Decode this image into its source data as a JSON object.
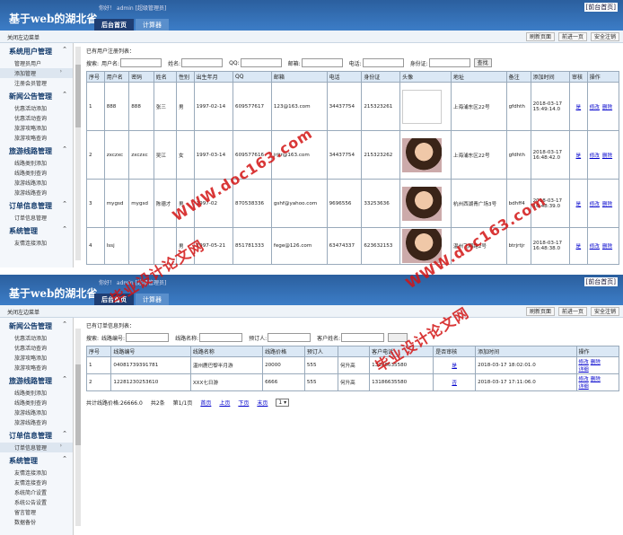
{
  "header": {
    "title": "基于web的湖北省",
    "hello": "你好！ admin [超级管理员]",
    "front": "[前台首页]",
    "tabs": [
      "后台首页",
      "计算器"
    ]
  },
  "toolbar": {
    "close": "关闭左边菜单",
    "buttons": [
      "刷新页面",
      "前进一页",
      "安全注销"
    ]
  },
  "watermark": {
    "text1": "毕业设计论文网",
    "text2": "WWW.doc163.com"
  },
  "users": {
    "sidebar": [
      {
        "title": "系统用户管理",
        "items": [
          "管理员用户",
          "添加管理",
          "注册会员管理"
        ],
        "selected": 1
      },
      {
        "title": "新闻公告管理",
        "items": [
          "优惠活动添加",
          "优惠活动查询",
          "旅游攻略添加",
          "旅游攻略查询"
        ]
      },
      {
        "title": "旅游线路管理",
        "items": [
          "线路类别添加",
          "线路类别查询",
          "旅游线路添加",
          "旅游线路查询"
        ]
      },
      {
        "title": "订单信息管理",
        "items": [
          "订单信息管理"
        ]
      },
      {
        "title": "系统管理",
        "items": [
          "友情连接添加"
        ]
      }
    ],
    "caption": "已有用户注册列表：",
    "search": {
      "label": "搜索:",
      "fields": [
        "用户名:",
        "姓名:",
        "QQ:",
        "邮箱:",
        "电话:",
        "身份证:"
      ],
      "button": "查找"
    },
    "columns": [
      "序号",
      "用户名",
      "密码",
      "姓名",
      "性别",
      "出生年月",
      "QQ",
      "邮箱",
      "电话",
      "身份证",
      "头像",
      "地址",
      "备注",
      "添加时间",
      "审核",
      "操作"
    ],
    "rows": [
      {
        "no": "1",
        "user": "888",
        "pwd": "888",
        "name": "张三",
        "sex": "男",
        "birth": "1997-02-14",
        "qq": "609577617",
        "email": "123@163.com",
        "tel": "34437754",
        "id": "215323261",
        "addr": "上海浦东区22号",
        "note": "gfdhth",
        "time1": "2018-03-17",
        "time2": "15:49:14.0",
        "audit": "是",
        "edit": "修改",
        "del": "删除"
      },
      {
        "no": "2",
        "user": "zxczxc",
        "pwd": "zxczxc",
        "name": "吴江",
        "sex": "女",
        "birth": "1997-03-14",
        "qq": "609577616",
        "email": "jrjtr@163.com",
        "tel": "34437754",
        "id": "215323262",
        "addr": "上海浦东区22号",
        "note": "gfdhth",
        "time1": "2018-03-17",
        "time2": "16:48:42.0",
        "audit": "是",
        "edit": "修改",
        "del": "删除"
      },
      {
        "no": "3",
        "user": "mygsd",
        "pwd": "mygsd",
        "name": "陈德才",
        "sex": "男",
        "birth": "1997-02",
        "qq": "870538336",
        "email": "gshf@yahoo.com",
        "tel": "9696556",
        "id": "33253636",
        "addr": "杭州西湖青广场3号",
        "note": "bdhff4",
        "time1": "2018-03-17",
        "time2": "16:48:39.0",
        "audit": "是",
        "edit": "修改",
        "del": "删除"
      },
      {
        "no": "4",
        "user": "lssj",
        "pwd": "",
        "name": "",
        "sex": "男",
        "birth": "1997-05-21",
        "qq": "851781333",
        "email": "fege@126.com",
        "tel": "63474337",
        "id": "623632153",
        "addr": "温州飞翔路2号",
        "note": "btrjrtjr",
        "time1": "2018-03-17",
        "time2": "16:48:38.0",
        "audit": "是",
        "edit": "修改",
        "del": "删除"
      }
    ]
  },
  "orders": {
    "sidebar": [
      {
        "title": "新闻公告管理",
        "items": [
          "优惠活动添加",
          "优惠活动查询",
          "旅游攻略添加",
          "旅游攻略查询"
        ]
      },
      {
        "title": "旅游线路管理",
        "items": [
          "线路类别添加",
          "线路类别查询",
          "旅游线路添加",
          "旅游线路查询"
        ]
      },
      {
        "title": "订单信息管理",
        "items": [
          "订单信息管理"
        ],
        "selected": 0
      },
      {
        "title": "系统管理",
        "items": [
          "友情连接添加",
          "友情连接查询",
          "系统简介设置",
          "系统公告设置",
          "留言管理",
          "数据备份"
        ]
      }
    ],
    "caption": "已有订单信息列表：",
    "search": {
      "label": "搜索:",
      "fields": [
        "线路编号:",
        "线路名称:",
        "预订人:",
        "客户姓名:"
      ]
    },
    "columns": [
      "序号",
      "线路编号",
      "线路名称",
      "线路价格",
      "预订人",
      "",
      "客户电话",
      "是否审核",
      "添加时间",
      "操作"
    ],
    "rows": [
      {
        "no": "1",
        "code": "04081739391781",
        "name": "温州鹿巴黎半月游",
        "price": "20000",
        "booker": "555",
        "cust": "何升高",
        "tel": "13186635580",
        "audit": "是",
        "time": "2018-03-17 18:02:01.0",
        "op1": "修改",
        "op2": "删除",
        "op3": "详细"
      },
      {
        "no": "2",
        "code": "12281230253610",
        "name": "XXX七日游",
        "price": "6666",
        "booker": "555",
        "cust": "何升高",
        "tel": "13186635580",
        "audit": "否",
        "time": "2018-03-17 17:11:06.0",
        "op1": "修改",
        "op2": "删除",
        "op3": "详细"
      }
    ],
    "pager": {
      "total": "共计线路价格:26666.0",
      "count": "共2条",
      "page": "第1/1页",
      "first": "首页",
      "prev": "上页",
      "next": "下页",
      "last": "末页",
      "select": "1 ▾"
    }
  }
}
